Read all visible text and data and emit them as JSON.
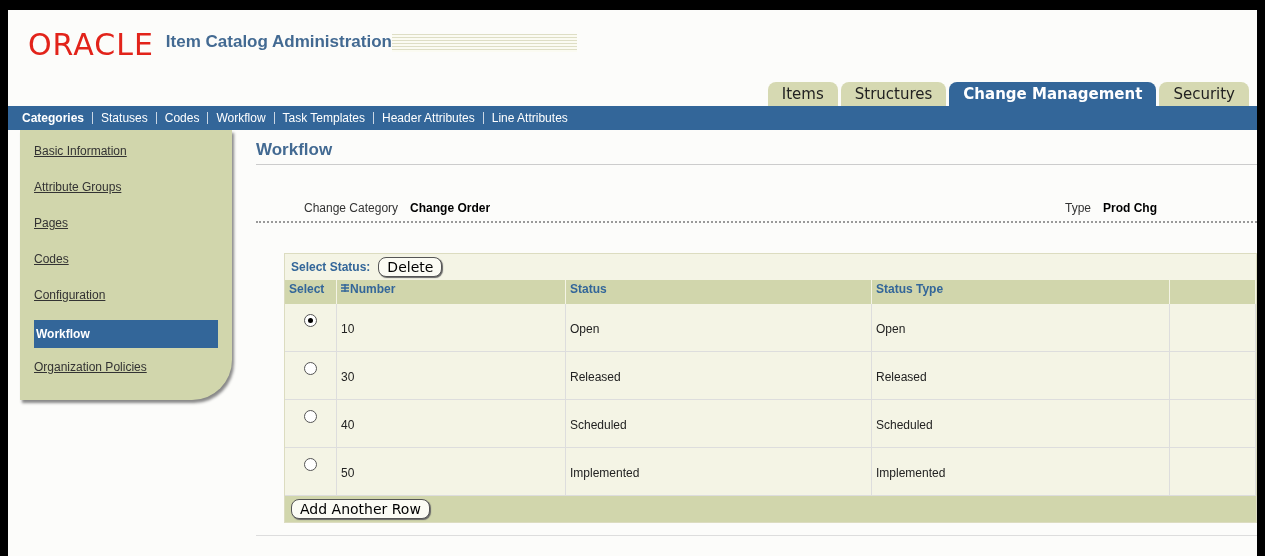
{
  "brand": {
    "logo": "ORACLE",
    "app_title": "Item Catalog Administration"
  },
  "tabs": [
    {
      "label": "Items",
      "selected": false
    },
    {
      "label": "Structures",
      "selected": false
    },
    {
      "label": "Change Management",
      "selected": true
    },
    {
      "label": "Security",
      "selected": false
    }
  ],
  "subnav": [
    {
      "label": "Categories",
      "selected": true
    },
    {
      "label": "Statuses",
      "selected": false
    },
    {
      "label": "Codes",
      "selected": false
    },
    {
      "label": "Workflow",
      "selected": false
    },
    {
      "label": "Task Templates",
      "selected": false
    },
    {
      "label": "Header Attributes",
      "selected": false
    },
    {
      "label": "Line Attributes",
      "selected": false
    }
  ],
  "sidebar": {
    "items": [
      {
        "label": "Basic Information",
        "selected": false
      },
      {
        "label": "Attribute Groups",
        "selected": false
      },
      {
        "label": "Pages",
        "selected": false
      },
      {
        "label": "Codes",
        "selected": false
      },
      {
        "label": "Configuration",
        "selected": false
      },
      {
        "label": "Workflow",
        "selected": true
      },
      {
        "label": "Organization Policies",
        "selected": false
      }
    ]
  },
  "page": {
    "heading": "Workflow",
    "fields": [
      {
        "label": "Change Category",
        "value": "Change Order"
      },
      {
        "label": "Type",
        "value": "Prod Chg"
      }
    ]
  },
  "table": {
    "select_label": "Select Status:",
    "delete_button": "Delete",
    "columns": [
      "Select",
      "Number",
      "Status",
      "Status Type"
    ],
    "rows": [
      {
        "number": "10",
        "status": "Open",
        "status_type": "Open",
        "selected": true
      },
      {
        "number": "30",
        "status": "Released",
        "status_type": "Released",
        "selected": false
      },
      {
        "number": "40",
        "status": "Scheduled",
        "status_type": "Scheduled",
        "selected": false
      },
      {
        "number": "50",
        "status": "Implemented",
        "status_type": "Implemented",
        "selected": false
      }
    ],
    "add_button": "Add Another Row"
  }
}
